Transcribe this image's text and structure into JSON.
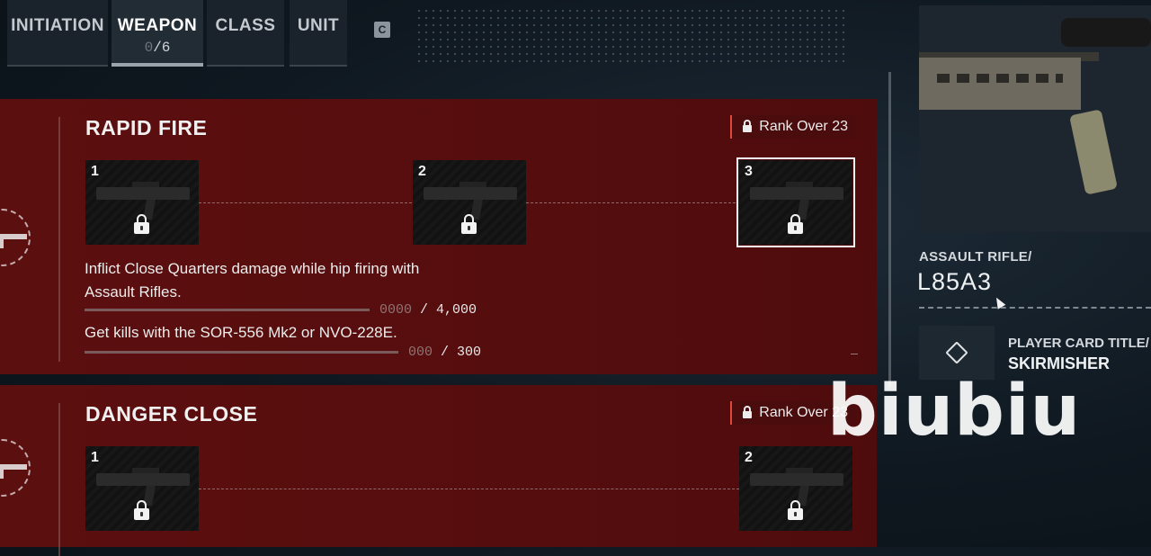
{
  "tabs": [
    {
      "label": "INITIATION",
      "active": false
    },
    {
      "label": "WEAPON",
      "active": true,
      "count_current": "0",
      "count_total": "/6"
    },
    {
      "label": "CLASS",
      "active": false
    },
    {
      "label": "UNIT",
      "active": false
    }
  ],
  "key_hint": "C",
  "challenges": [
    {
      "title": "RAPID FIRE",
      "rank": "Rank Over 23",
      "tiers": [
        "1",
        "2",
        "3"
      ],
      "selected_tier": "3",
      "tasks": [
        {
          "text": "Inflict Close Quarters damage while hip firing with Assault Rifles.",
          "progress_current": "0000",
          "progress_target": "/ 4,000",
          "progress": 0
        },
        {
          "text": "Get kills with the SOR-556 Mk2 or NVO-228E.",
          "progress_current": "000",
          "progress_target": "/ 300",
          "progress": 0
        }
      ]
    },
    {
      "title": "DANGER CLOSE",
      "rank": "Rank Over 23",
      "tiers": [
        "1",
        "2"
      ]
    }
  ],
  "weapon": {
    "type_label": "ASSAULT RIFLE/",
    "name": "L85A3"
  },
  "reward": {
    "label": "PLAYER CARD TITLE/",
    "value": "SKIRMISHER"
  },
  "watermark": "biubiu",
  "colors": {
    "panel_red": "#5a0e0e",
    "rank_accent": "#e0463a",
    "background": "#0f1820"
  }
}
